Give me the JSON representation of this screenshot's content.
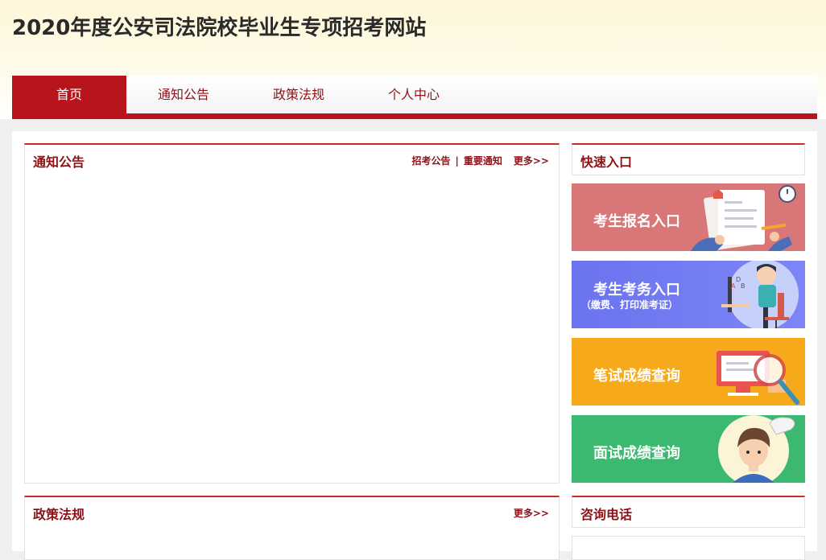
{
  "site": {
    "title": "2020年度公安司法院校毕业生专项招考网站"
  },
  "nav": {
    "items": [
      "首页",
      "通知公告",
      "政策法规",
      "个人中心"
    ]
  },
  "notice_panel": {
    "title": "通知公告",
    "link1": "招考公告",
    "separator": "|",
    "link2": "重要通知",
    "more": "更多>>"
  },
  "policy_panel": {
    "title": "政策法规",
    "more": "更多>>"
  },
  "quick_entry": {
    "title": "快速入口",
    "tiles": [
      {
        "label": "考生报名入口",
        "color": "#d97678"
      },
      {
        "label": "考生考务入口",
        "sublabel": "（缴费、打印准考证）",
        "color": "#6d79f0"
      },
      {
        "label": "笔试成绩查询",
        "color": "#f6a91b"
      },
      {
        "label": "面试成绩查询",
        "color": "#3cb970"
      }
    ]
  },
  "consult_panel": {
    "title": "咨询电话"
  },
  "colors": {
    "brand_red": "#b8141c",
    "title_red": "#8d1218"
  }
}
